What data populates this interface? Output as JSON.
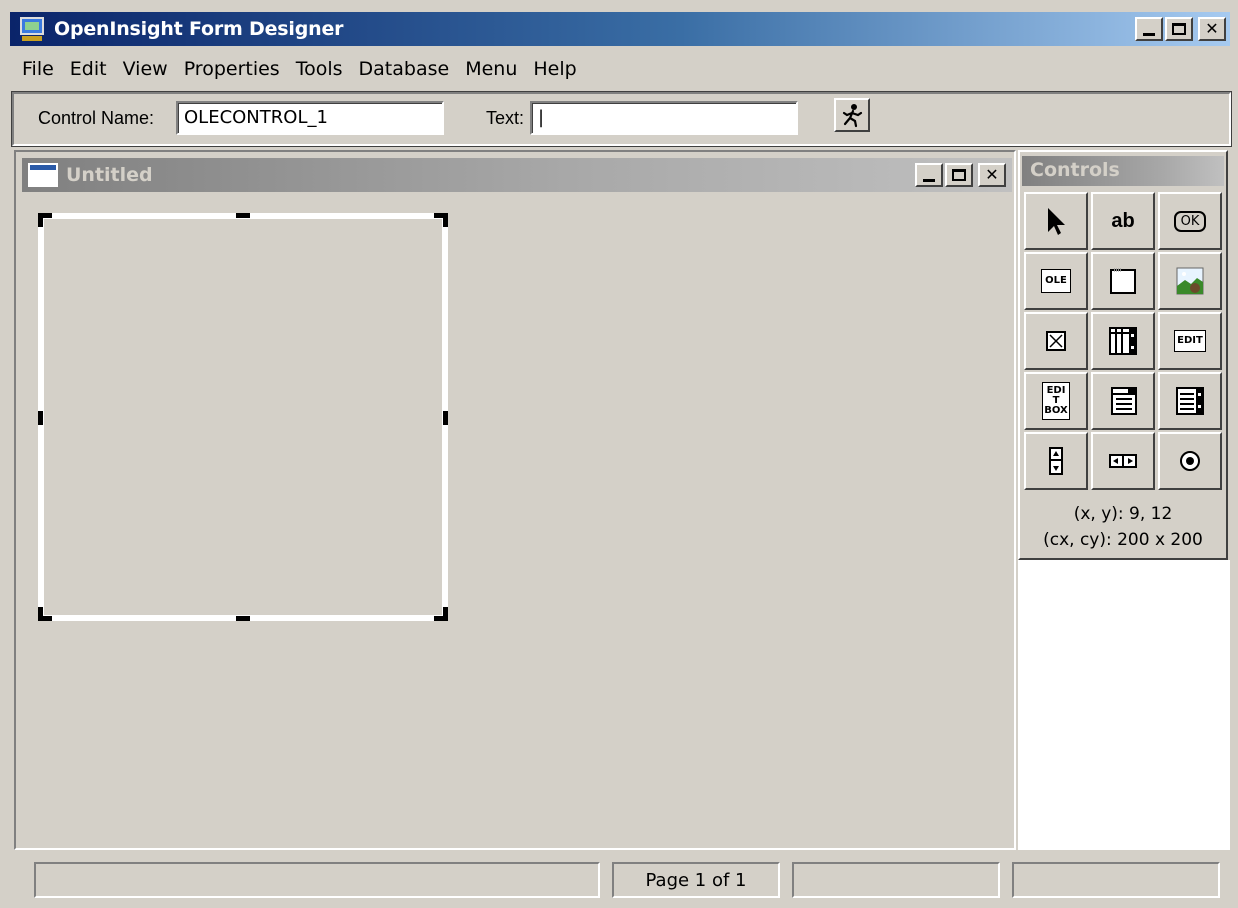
{
  "window": {
    "title": "OpenInsight Form Designer",
    "buttons": {
      "minimize": "_",
      "maximize": "□",
      "close": "✕"
    }
  },
  "menu": {
    "items": [
      "File",
      "Edit",
      "View",
      "Properties",
      "Tools",
      "Database",
      "Menu",
      "Help"
    ]
  },
  "toolbar": {
    "control_name_label": "Control Name:",
    "control_name_value": "OLECONTROL_1",
    "text_label": "Text:",
    "text_value": "|"
  },
  "form": {
    "title": "Untitled",
    "selected_control_caption": ""
  },
  "palette": {
    "title": "Controls",
    "tools": [
      {
        "name": "pointer-tool",
        "icon": "arrow-pointer-icon",
        "label": ""
      },
      {
        "name": "static-text-tool",
        "icon": "text-ab-icon",
        "label": "ab"
      },
      {
        "name": "push-button-tool",
        "icon": "ok-button-icon",
        "label": "OK"
      },
      {
        "name": "ole-control-tool",
        "icon": "ole-icon",
        "label": "OLE"
      },
      {
        "name": "group-box-tool",
        "icon": "group-box-icon",
        "label": ""
      },
      {
        "name": "bitmap-tool",
        "icon": "bitmap-picture-icon",
        "label": ""
      },
      {
        "name": "checkbox-tool",
        "icon": "checkbox-icon",
        "label": ""
      },
      {
        "name": "edit-table-tool",
        "icon": "edit-table-icon",
        "label": ""
      },
      {
        "name": "edit-line-tool",
        "icon": "edit-line-icon",
        "label": "EDIT"
      },
      {
        "name": "edit-box-tool",
        "icon": "edit-box-icon",
        "label": "EDIT BOX"
      },
      {
        "name": "combo-box-tool",
        "icon": "combo-box-icon",
        "label": ""
      },
      {
        "name": "list-box-tool",
        "icon": "list-box-icon",
        "label": ""
      },
      {
        "name": "vertical-scrollbar-tool",
        "icon": "vertical-scrollbar-icon",
        "label": ""
      },
      {
        "name": "horizontal-scrollbar-tool",
        "icon": "horizontal-scrollbar-icon",
        "label": ""
      },
      {
        "name": "radio-button-tool",
        "icon": "radio-button-icon",
        "label": ""
      }
    ],
    "position_readout": "(x, y): 9, 12",
    "size_readout": "(cx, cy): 200 x 200"
  },
  "statusbar": {
    "panes": [
      "",
      "Page 1 of 1",
      "",
      ""
    ]
  },
  "colors": {
    "face": "#d4d0c8",
    "active_title_start": "#0a246a",
    "active_title_end": "#a6caf0",
    "inactive_title_start": "#808080",
    "inactive_title_end": "#c0c0c0"
  }
}
